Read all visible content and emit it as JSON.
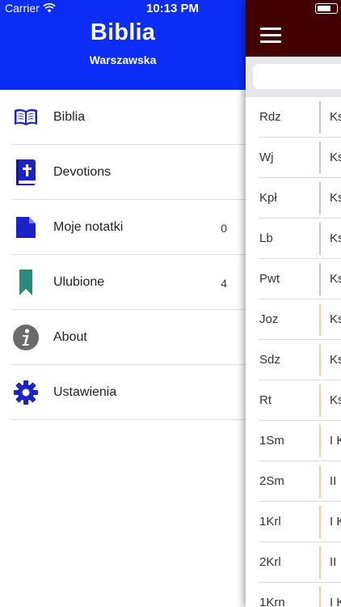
{
  "status_bar": {
    "carrier": "Carrier",
    "time": "10:13 PM"
  },
  "drawer": {
    "title": "Biblia",
    "subtitle": "Warszawska",
    "items": [
      {
        "label": "Biblia",
        "icon": "open-book-icon",
        "count": ""
      },
      {
        "label": "Devotions",
        "icon": "bible-cross-icon",
        "count": ""
      },
      {
        "label": "Moje notatki",
        "icon": "note-document-icon",
        "count": "0"
      },
      {
        "label": "Ulubione",
        "icon": "bookmark-icon",
        "count": "4"
      },
      {
        "label": "About",
        "icon": "info-icon",
        "count": ""
      },
      {
        "label": "Ustawienia",
        "icon": "gear-icon",
        "count": ""
      }
    ]
  },
  "books": {
    "rows": [
      {
        "abbr": "Rdz",
        "name": "Ks"
      },
      {
        "abbr": "Wj",
        "name": "Ks"
      },
      {
        "abbr": "Kpł",
        "name": "Ks"
      },
      {
        "abbr": "Lb",
        "name": "Ks"
      },
      {
        "abbr": "Pwt",
        "name": "Ks"
      },
      {
        "abbr": "Joz",
        "name": "Ks"
      },
      {
        "abbr": "Sdz",
        "name": "Ks"
      },
      {
        "abbr": "Rt",
        "name": "Ks"
      },
      {
        "abbr": "1Sm",
        "name": "I K"
      },
      {
        "abbr": "2Sm",
        "name": "II"
      },
      {
        "abbr": "1Krl",
        "name": "I K"
      },
      {
        "abbr": "2Krl",
        "name": "II"
      },
      {
        "abbr": "1Krn",
        "name": "I K"
      }
    ]
  },
  "colors": {
    "drawer_header": "#0b2df5",
    "panel_header": "#420000",
    "pentateuch_divider": "#c7c3f0",
    "history_divider": "#f5cf9d",
    "icon_blue": "#1a22c8",
    "bookmark_teal": "#2e8a78",
    "info_gray": "#6b6b6b"
  }
}
